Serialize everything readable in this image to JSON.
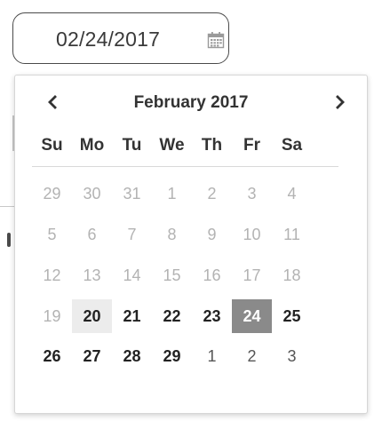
{
  "date_input": {
    "value": "02/24/2017",
    "icon": "calendar-icon"
  },
  "calendar": {
    "title": "February 2017",
    "prev_icon": "chevron-left-icon",
    "next_icon": "chevron-right-icon",
    "weekdays": [
      "Su",
      "Mo",
      "Tu",
      "We",
      "Th",
      "Fr",
      "Sa"
    ],
    "weeks": [
      [
        {
          "d": "29",
          "s": "muted"
        },
        {
          "d": "30",
          "s": "muted"
        },
        {
          "d": "31",
          "s": "muted"
        },
        {
          "d": "1",
          "s": "muted"
        },
        {
          "d": "2",
          "s": "muted"
        },
        {
          "d": "3",
          "s": "muted"
        },
        {
          "d": "4",
          "s": "muted"
        }
      ],
      [
        {
          "d": "5",
          "s": "muted"
        },
        {
          "d": "6",
          "s": "muted"
        },
        {
          "d": "7",
          "s": "muted"
        },
        {
          "d": "8",
          "s": "muted"
        },
        {
          "d": "9",
          "s": "muted"
        },
        {
          "d": "10",
          "s": "muted"
        },
        {
          "d": "11",
          "s": "muted"
        }
      ],
      [
        {
          "d": "12",
          "s": "muted"
        },
        {
          "d": "13",
          "s": "muted"
        },
        {
          "d": "14",
          "s": "muted"
        },
        {
          "d": "15",
          "s": "muted"
        },
        {
          "d": "16",
          "s": "muted"
        },
        {
          "d": "17",
          "s": "muted"
        },
        {
          "d": "18",
          "s": "muted"
        }
      ],
      [
        {
          "d": "19",
          "s": "muted"
        },
        {
          "d": "20",
          "s": "current highlight"
        },
        {
          "d": "21",
          "s": "current"
        },
        {
          "d": "22",
          "s": "current"
        },
        {
          "d": "23",
          "s": "current"
        },
        {
          "d": "24",
          "s": "selected"
        },
        {
          "d": "25",
          "s": "current"
        }
      ],
      [
        {
          "d": "26",
          "s": "current"
        },
        {
          "d": "27",
          "s": "current"
        },
        {
          "d": "28",
          "s": "current"
        },
        {
          "d": "29",
          "s": "current"
        },
        {
          "d": "1",
          "s": "next-month"
        },
        {
          "d": "2",
          "s": "next-month"
        },
        {
          "d": "3",
          "s": "next-month"
        }
      ]
    ],
    "colors": {
      "selected_bg": "#8a8a8a",
      "highlight_bg": "#ececec",
      "muted_text": "#b3b3b3"
    }
  }
}
